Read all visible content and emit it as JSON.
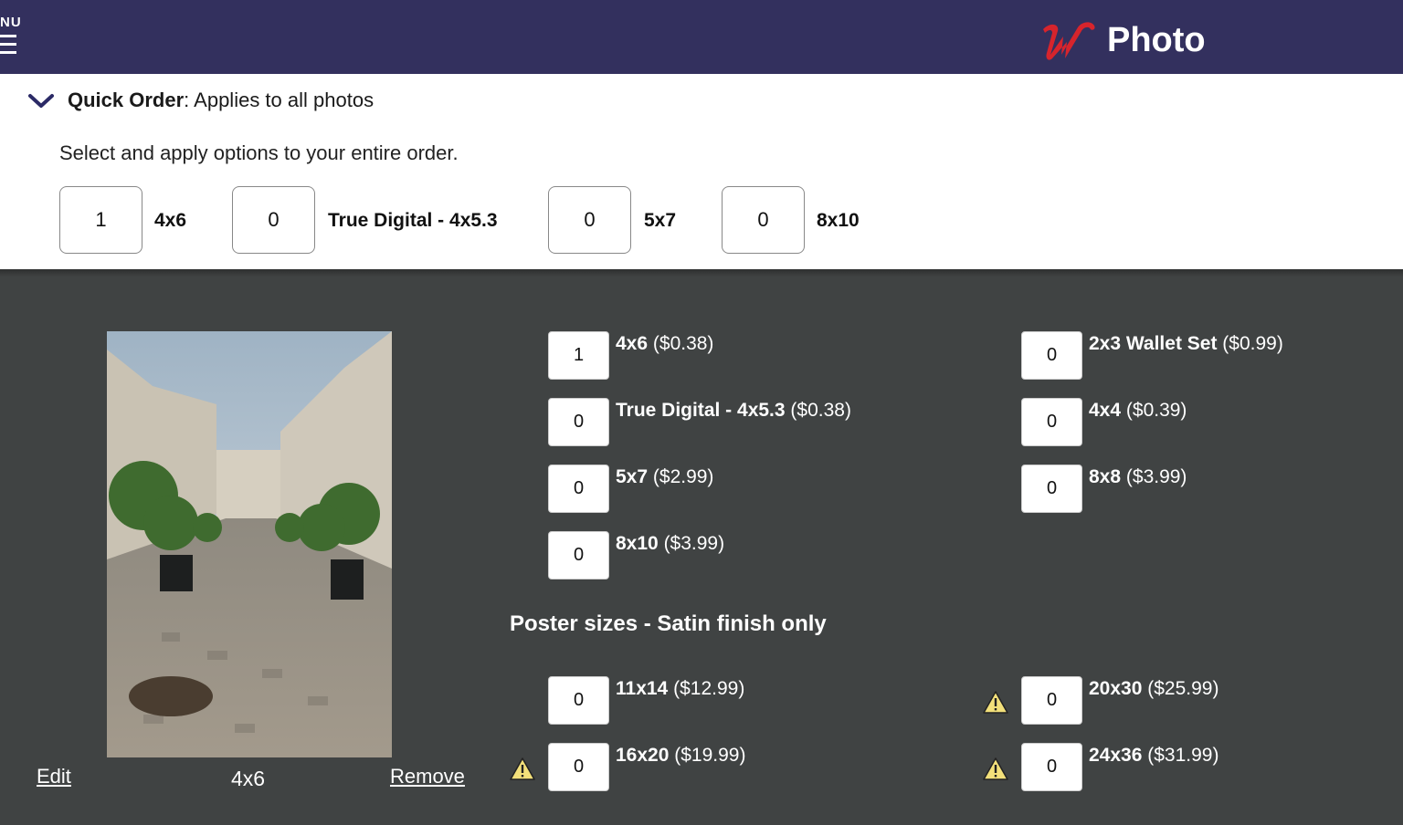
{
  "header": {
    "menu_label": "NU",
    "brand_text": "Photo",
    "brand_color": "#d7242c",
    "background": "#33305e"
  },
  "quick_order": {
    "title_bold": "Quick Order",
    "title_rest": ": Applies to all photos",
    "subtitle": "Select and apply options to your entire order.",
    "items": [
      {
        "qty": "1",
        "label": "4x6"
      },
      {
        "qty": "0",
        "label": "True Digital - 4x5.3"
      },
      {
        "qty": "0",
        "label": "5x7"
      },
      {
        "qty": "0",
        "label": "8x10"
      }
    ]
  },
  "photo_card": {
    "image_alt": "Cobblestone courtyard lined with potted trees",
    "edit_label": "Edit",
    "size_label": "4x6",
    "remove_label": "Remove"
  },
  "print_options": {
    "left": [
      {
        "qty": "1",
        "size": "4x6",
        "price": "($0.38)"
      },
      {
        "qty": "0",
        "size": "True Digital - 4x5.3",
        "price": "($0.38)"
      },
      {
        "qty": "0",
        "size": "5x7",
        "price": "($2.99)"
      },
      {
        "qty": "0",
        "size": "8x10",
        "price": "($3.99)"
      }
    ],
    "right": [
      {
        "qty": "0",
        "size": "2x3 Wallet Set",
        "price": "($0.99)"
      },
      {
        "qty": "0",
        "size": "4x4",
        "price": "($0.39)"
      },
      {
        "qty": "0",
        "size": "8x8",
        "price": "($3.99)"
      }
    ]
  },
  "poster": {
    "title": "Poster sizes - Satin finish only",
    "items": [
      {
        "qty": "0",
        "size": "11x14",
        "price": "($12.99)",
        "warning": false
      },
      {
        "qty": "0",
        "size": "20x30",
        "price": "($25.99)",
        "warning": true
      },
      {
        "qty": "0",
        "size": "16x20",
        "price": "($19.99)",
        "warning": true
      },
      {
        "qty": "0",
        "size": "24x36",
        "price": "($31.99)",
        "warning": true
      }
    ]
  },
  "icons": {
    "menu": "hamburger-menu-icon",
    "collapse": "chevron-down-icon",
    "warning": "warning-triangle-icon",
    "logo": "walgreens-w-logo"
  }
}
